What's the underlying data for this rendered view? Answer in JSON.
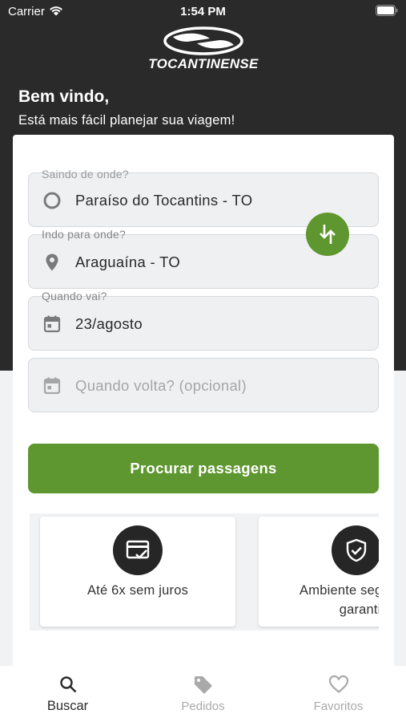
{
  "status_bar": {
    "carrier": "Carrier",
    "time": "1:54 PM"
  },
  "brand": {
    "name": "TOCANTINENSE",
    "accent_color": "#5e962f",
    "header_color": "#2a2a2a"
  },
  "welcome": {
    "title": "Bem vindo,",
    "subtitle": "Está mais fácil planejar sua viagem!"
  },
  "form": {
    "origin": {
      "label": "Saindo de onde?",
      "value": "Paraíso do Tocantins - TO",
      "icon": "radio-circle-icon"
    },
    "destination": {
      "label": "Indo para onde?",
      "value": "Araguaína - TO",
      "icon": "location-pin-icon"
    },
    "departure": {
      "label": "Quando vai?",
      "value": "23/agosto",
      "icon": "calendar-icon"
    },
    "return": {
      "placeholder": "Quando volta? (opcional)",
      "icon": "calendar-icon"
    },
    "swap_icon": "swap-arrows-icon",
    "search_label": "Procurar passagens"
  },
  "features": [
    {
      "icon": "credit-card-check-icon",
      "label": "Até 6x sem juros"
    },
    {
      "icon": "shield-check-icon",
      "label_line1": "Ambiente seguro e",
      "label_line2": "garantido"
    }
  ],
  "tabs": [
    {
      "label": "Buscar",
      "icon": "search-icon",
      "active": true
    },
    {
      "label": "Pedidos",
      "icon": "tag-icon",
      "active": false
    },
    {
      "label": "Favoritos",
      "icon": "heart-icon",
      "active": false
    }
  ]
}
